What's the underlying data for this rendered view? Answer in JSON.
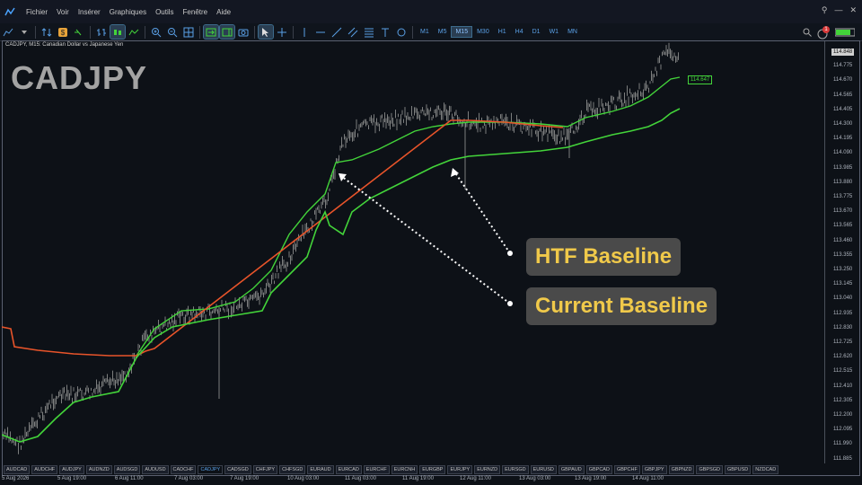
{
  "menu": {
    "items": [
      "Fichier",
      "Voir",
      "Insérer",
      "Graphiques",
      "Outils",
      "Fenêtre",
      "Aide"
    ]
  },
  "toolbar": {
    "timeframes": [
      "M1",
      "M5",
      "M15",
      "M30",
      "H1",
      "H4",
      "D1",
      "W1",
      "MN"
    ],
    "active_timeframe": "M15",
    "notification_count": "1"
  },
  "chart": {
    "header": "CADJPY, M15:  Canadian Dollar vs Japanese Yen",
    "symbol": "CADJPY",
    "current_price": "114.848",
    "baseline_price": "114.647",
    "price_ticks": [
      "114.848",
      "114.775",
      "114.670",
      "114.565",
      "114.405",
      "114.300",
      "114.195",
      "114.090",
      "113.985",
      "113.880",
      "113.775",
      "113.670",
      "113.565",
      "113.460",
      "113.355",
      "113.250",
      "113.145",
      "113.040",
      "112.935",
      "112.830",
      "112.725",
      "112.620",
      "112.515",
      "112.410",
      "112.305",
      "112.200",
      "112.095",
      "111.990",
      "111.885"
    ],
    "time_ticks": [
      "5 Aug 2026",
      "5 Aug 19:00",
      "6 Aug 11:00",
      "7 Aug 03:00",
      "7 Aug 19:00",
      "10 Aug 03:00",
      "11 Aug 03:00",
      "11 Aug 19:00",
      "12 Aug 11:00",
      "13 Aug 03:00",
      "13 Aug 19:00",
      "14 Aug 11:00"
    ],
    "colors": {
      "htf_baseline": "#e8542a",
      "current_baseline": "#43d43a",
      "candles": "#9a9a9a",
      "label_text": "#f0c94a",
      "label_bg": "#4a4a4a"
    }
  },
  "labels": {
    "htf": "HTF Baseline",
    "current": "Current Baseline"
  },
  "symbol_tabs": [
    "AUDCAD",
    "AUDCHF",
    "AUDJPY",
    "AUDNZD",
    "AUDSGD",
    "AUDUSD",
    "CADCHF",
    "CADJPY",
    "CADSGD",
    "CHFJPY",
    "CHFSGD",
    "EURAUD",
    "EURCAD",
    "EURCHF",
    "EURCNH",
    "EURGBP",
    "EURJPY",
    "EURNZD",
    "EURSGD",
    "EURUSD",
    "GBPAUD",
    "GBPCAD",
    "GBPCHF",
    "GBPJPY",
    "GBPNZD",
    "GBPSGD",
    "GBPUSD",
    "NZDCAD"
  ],
  "active_tab": "CADJPY"
}
